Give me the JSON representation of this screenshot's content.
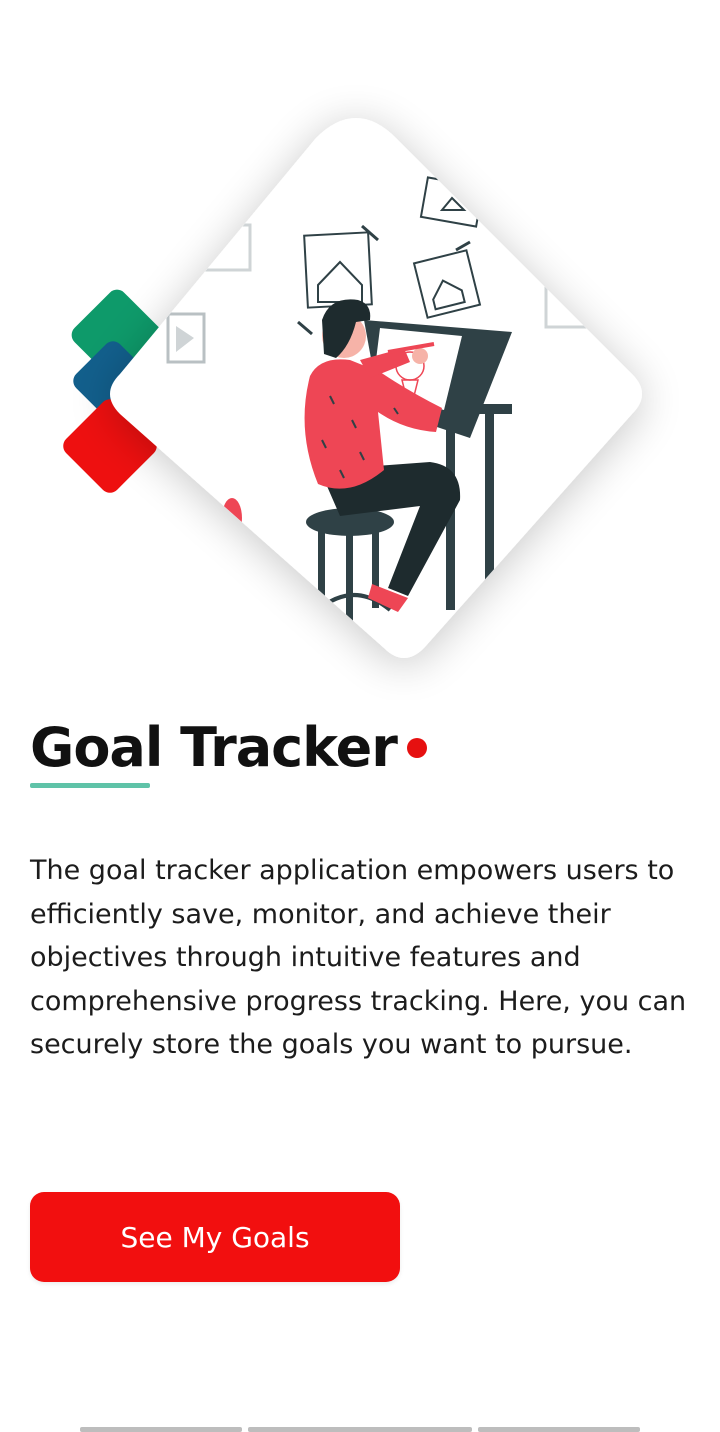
{
  "app": {
    "title": "Goal Tracker",
    "description": "The goal tracker application empowers users to efficiently save, monitor, and achieve their objectives through intuitive features and comprehensive progress tracking. Here, you can securely store the goals you want to pursue.",
    "cta_label": "See My Goals"
  },
  "colors": {
    "accent_red": "#f20f0f",
    "accent_teal": "#5fc3a8",
    "accent_green": "#0e9a6a",
    "accent_blue": "#125f8c",
    "title_text": "#111111",
    "body_text": "#1c1c1c",
    "illustration_dark": "#2f4146",
    "illustration_shirt": "#ee4655"
  },
  "icons": {
    "hero_illustration": "person-drawing-at-desk-illustration",
    "decor_tiles": "stacked-color-tiles-icon",
    "title_dot": "red-dot-icon"
  }
}
